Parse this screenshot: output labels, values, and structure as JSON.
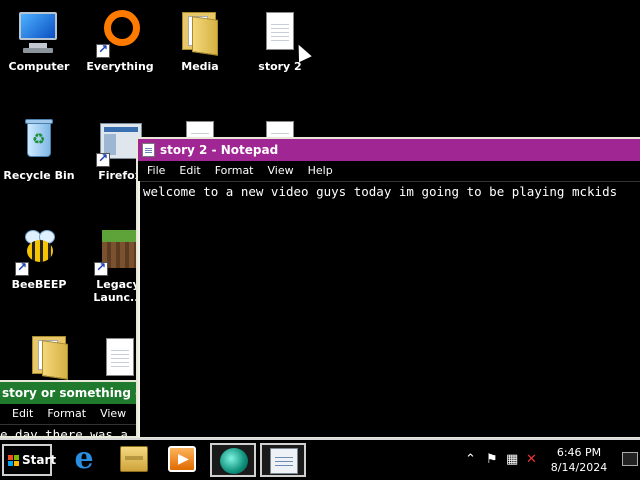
{
  "desktop_icons": [
    {
      "label": "Computer",
      "icon": "computer-icon"
    },
    {
      "label": "Everything",
      "icon": "everything-icon",
      "shortcut": true
    },
    {
      "label": "Media",
      "icon": "folder-icon"
    },
    {
      "label": "story 2",
      "icon": "text-document-icon"
    },
    {
      "label": "Recycle Bin",
      "icon": "recycle-bin-icon"
    },
    {
      "label": "Firefox",
      "icon": "firefox-icon",
      "shortcut": true
    },
    {
      "label": "BeeBEEP",
      "icon": "beebeep-icon",
      "shortcut": true
    },
    {
      "label": "Legacy Launc...",
      "icon": "minecraft-launcher-icon",
      "shortcut": true
    }
  ],
  "notepad_main": {
    "title": "story 2 - Notepad",
    "menu": [
      "File",
      "Edit",
      "Format",
      "View",
      "Help"
    ],
    "text": "welcome to a new video guys today im going to be playing mckids"
  },
  "notepad_back": {
    "title": "story or something - Not",
    "menu": [
      "Edit",
      "Format",
      "View",
      "He"
    ],
    "text": "e day there was a"
  },
  "taskbar": {
    "start_label": "Start",
    "buttons": [
      "internet-explorer-icon",
      "file-explorer-icon",
      "media-player-icon",
      "feather-app-icon",
      "notepad-icon"
    ],
    "tray_icons": [
      "chevron-up-icon",
      "flag-icon",
      "network-icon",
      "volume-muted-icon"
    ],
    "time": "6:46 PM",
    "date": "8/14/2024"
  },
  "colors": {
    "titlebar": "#a02693",
    "desktop": "#000000",
    "window_frame": "#f2f2e6"
  }
}
